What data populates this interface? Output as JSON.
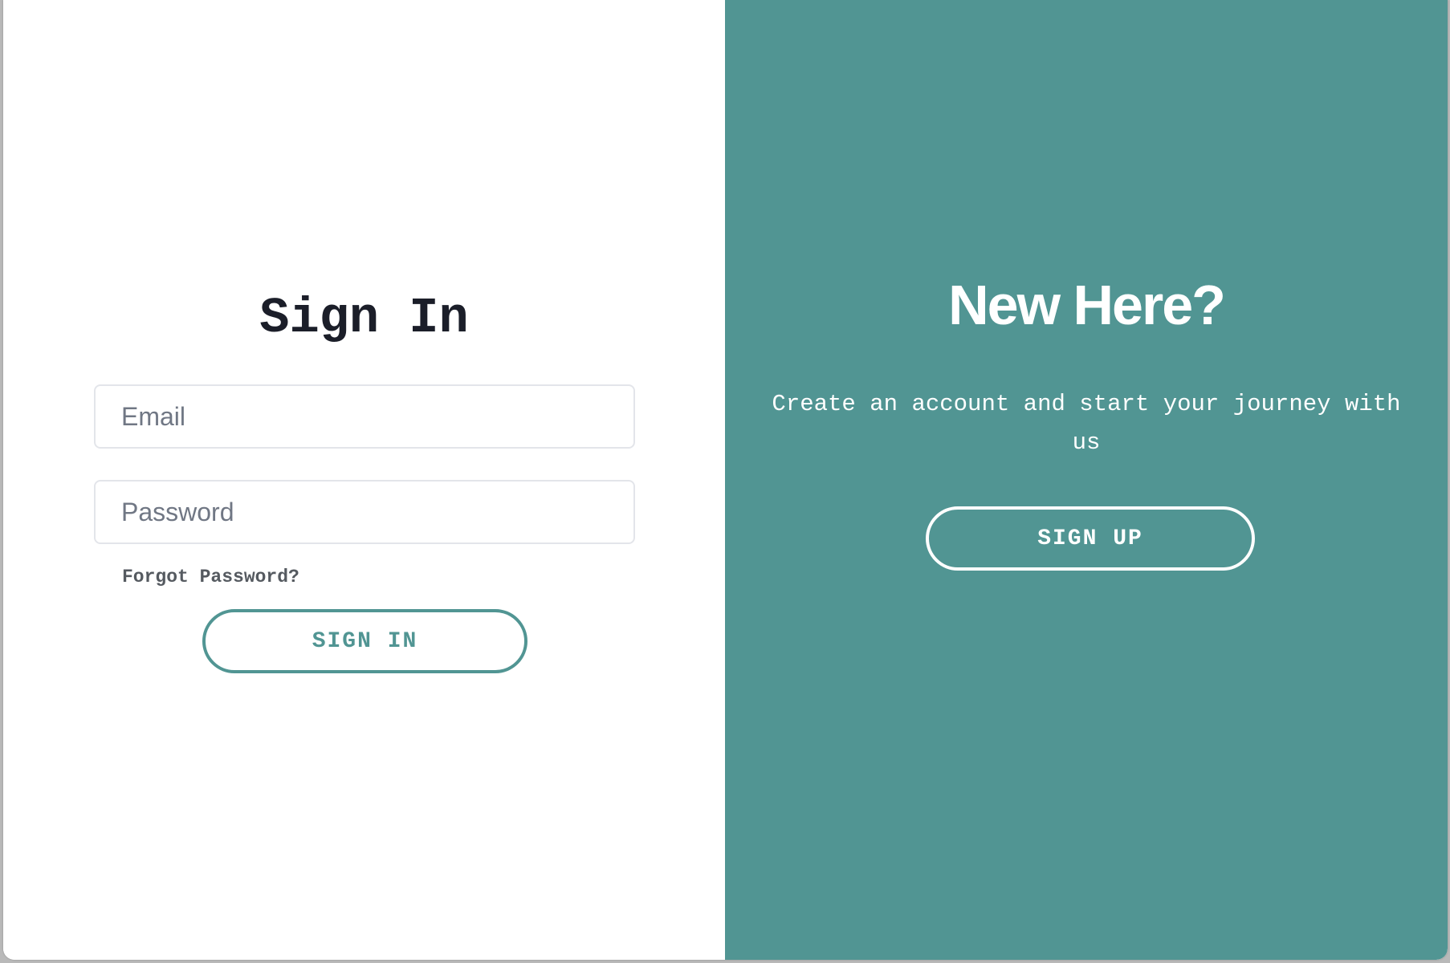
{
  "colors": {
    "accent": "#519593",
    "heading_dark": "#1b1e29",
    "panel_text": "#ffffff",
    "input_border": "#e3e5ea",
    "placeholder": "#707784"
  },
  "sign_in": {
    "title": "Sign In",
    "email_placeholder": "Email",
    "password_placeholder": "Password",
    "forgot_password": "Forgot Password?",
    "button_label": "SIGN IN"
  },
  "sign_up": {
    "title": "New Here?",
    "subtitle": "Create an account and start your journey with us",
    "button_label": "SIGN UP"
  }
}
